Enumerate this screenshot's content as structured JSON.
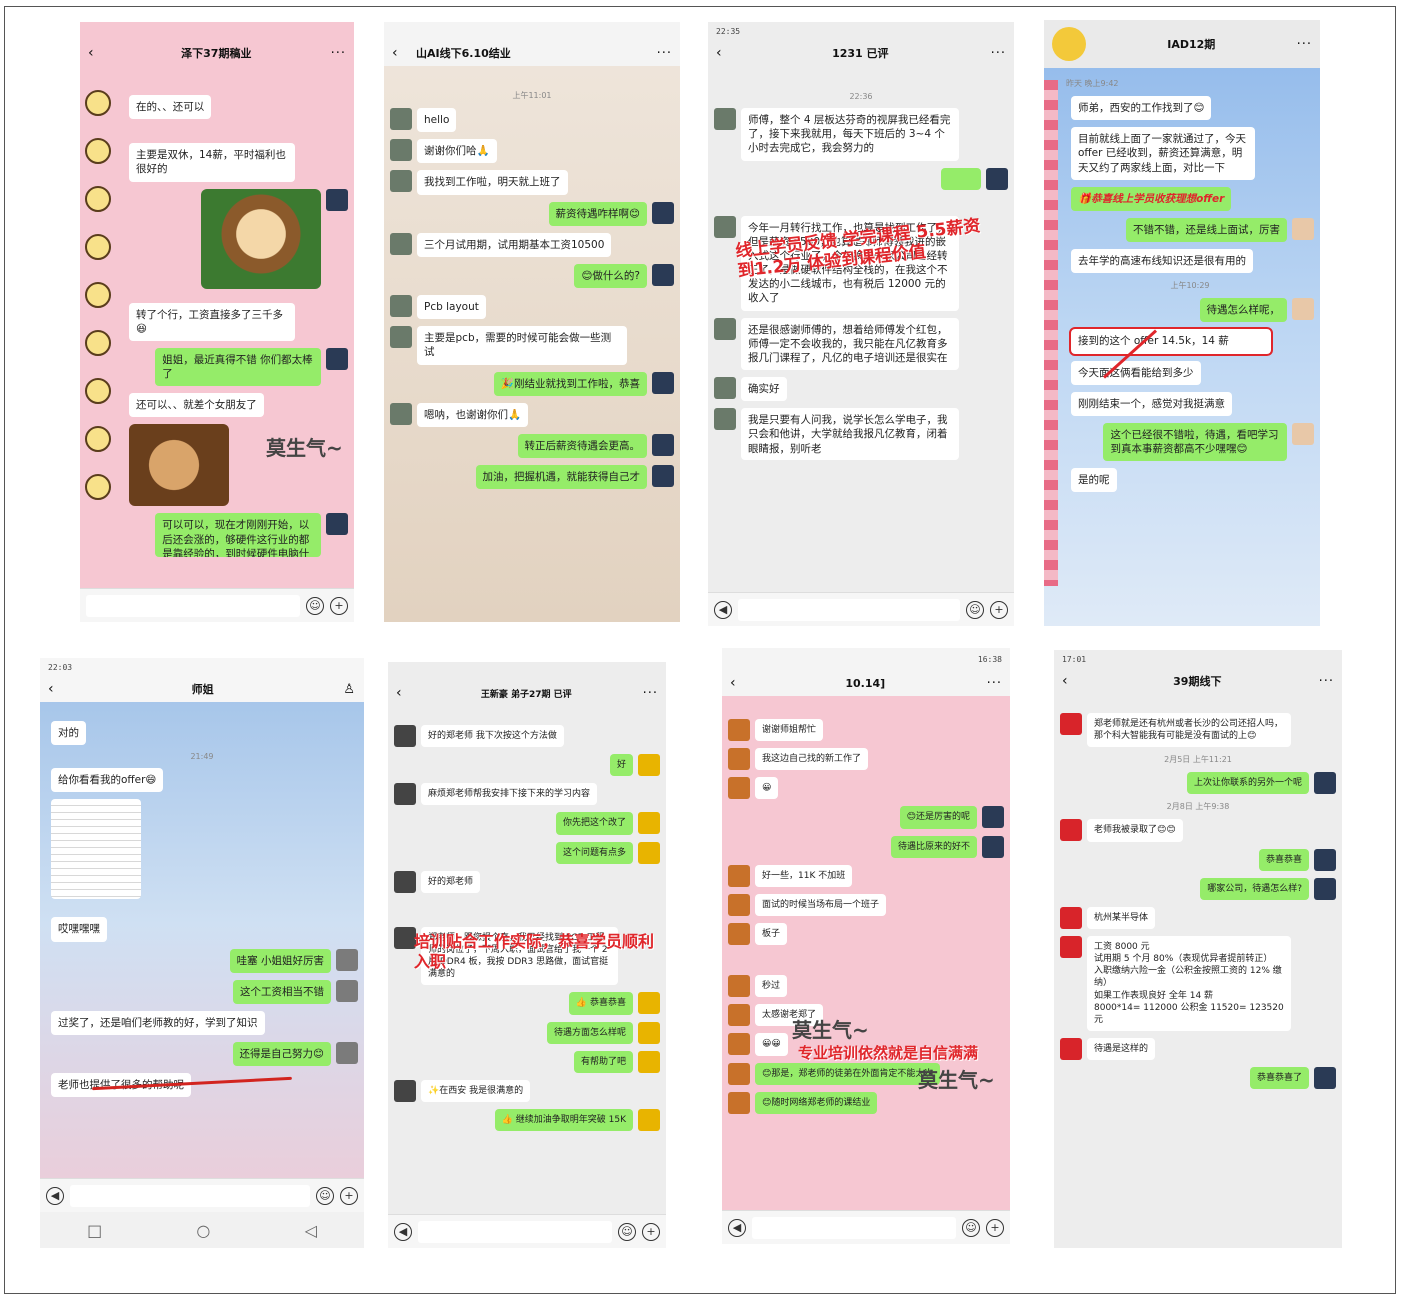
{
  "colors": {
    "wechat_green": "#95ec69",
    "bubble_white": "#ffffff",
    "highlight_red": "#e0262b",
    "pink_wallpaper": "#f6c7d2"
  },
  "icons": {
    "voice": "voice-icon",
    "emoji": "emoji-icon",
    "add": "add-icon",
    "back": "back-arrow-icon",
    "more": "more-icon",
    "person": "person-icon"
  },
  "p1": {
    "status": "",
    "title": "泽下37期稿业",
    "messages": [
      "在的、、还可以",
      "主要是双休，14薪，平时福利也很好的",
      "转了个行，工资直接多了三千多😆",
      "姐姐，最近真得不错 你们都太棒了",
      "还可以、、就差个女朋友了",
      "可以可以，现在才刚刚开始，以后还会涨的，够硬件这行业的都是靠经验的，到时候硬件电脑什么的都可以了"
    ],
    "overlay": "莫生气~"
  },
  "p2": {
    "title": "山AI线下6.10结业",
    "time1": "上午11:01",
    "messages": [
      "hello",
      "谢谢你们哈🙏",
      "我找到工作啦，明天就上班了",
      "薪资待遇咋样啊😊",
      "三个月试用期，试用期基本工资10500",
      "😊做什么的?",
      "Pcb layout",
      "主要是pcb，需要的时候可能会做一些测试",
      "🎉刚结业就找到工作啦，恭喜",
      "嗯呐，也谢谢你们🙏",
      "转正后薪资待遇会更高。",
      "加油，把握机遇，就能获得自己才"
    ]
  },
  "p3": {
    "status": "22:35",
    "title": "1231 已评",
    "time1": "22:36",
    "messages": [
      "师傅，整个 4 层板达芬奇的视屏我已经看完了，接下来我就用，每天下班后的 3~4 个小时去完成它，我会努力的",
      "今年一月转行找工作，也算是找到工作了，但是薪资 5500，也算是郑师傅领我进的嵌入式这个行业了，今年换了一家公司已经转正了，是做硬软件结构全栈的，在我这个不发达的小二线城市，也有税后 12000 元的收入了",
      "还是很感谢师傅的，想着给师傅发个红包，师傅一定不会收我的，我只能在凡亿教育多报几门课程了，凡亿的电子培训还是很实在",
      "确实好",
      "我是只要有人问我，说学长怎么学电子，我只会和他讲，大学就给我报凡亿教育，闭着眼睛报，别听老"
    ],
    "overlay": "线上学员反馈 学完课程 5.5薪资到1.2万 体验到课程价值"
  },
  "p4": {
    "title": "IAD12期",
    "time1": "昨天 晚上9:42",
    "time2": "上午10:29",
    "messages": [
      "师弟，西安的工作找到了😊",
      "目前就线上面了一家就通过了，今天 offer 已经收到，薪资还算满意，明天又约了两家线上面，对比一下",
      "不错不错，还是线上面试，厉害",
      "去年学的高速布线知识还是很有用的",
      "待遇怎么样呢，",
      "接到的这个 offer 14.5k，14 薪",
      "今天面这俩看能给到多少",
      "刚刚结束一个，感觉对我挺满意",
      "这个已经很不错啦，待遇，看吧学习到真本事薪资都高不少嘿嘿😊",
      "是的呢"
    ],
    "overlay": "🎁恭喜线上学员收获理想offer"
  },
  "p5": {
    "status": "22:03",
    "title": "师姐",
    "time1": "21:49",
    "messages": [
      "对的",
      "给你看看我的offer😄",
      "哎嘿嘿嘿",
      "哇塞 小姐姐好厉害",
      "这个工资相当不错",
      "过奖了，还是咱们老师教的好，学到了知识",
      "还得是自己努力😊",
      "老师也提供了很多的帮助呢"
    ]
  },
  "p6": {
    "title": "王新豪 弟子27期 已评",
    "messages": [
      "好的郑老师 我下次按这个方法做",
      "好",
      "麻烦郑老师帮我安排下接下来的学习内容",
      "你先把这个改了",
      "这个问题有点多",
      "好的郑老师",
      "郑老师，跟您报个喜，我已经找到 PCB 工程师的岗位了，下周入职，面试官给了我一个 2 片 DDR4 板，我按 DDR3 思路做，面试官挺满意的",
      "👍 恭喜恭喜",
      "待遇方面怎么样呢",
      "有帮助了吧",
      "✨在西安 我是很满意的",
      "👍 继续加油争取明年突破 15K"
    ],
    "overlay": "培训贴合工作实际，恭喜学员顺利入职"
  },
  "p7": {
    "status": "16:38",
    "title": "10.14]",
    "messages": [
      "谢谢师姐帮忙",
      "我这边自己找的新工作了",
      "😀",
      "😊还是厉害的呢",
      "待遇比原来的好不",
      "好一些，11K 不加班",
      "面试的时候当场布局一个班子",
      "板子",
      "秒过",
      "太感谢老郑了",
      "😀😀",
      "😊那是，郑老师的徒弟在外面肯定不能太次",
      "😊随时网络郑老师的课结业"
    ],
    "overlay1": "莫生气~",
    "overlay2": "专业培训依然就是自信满满"
  },
  "p8": {
    "status": "17:01",
    "title": "39期线下",
    "time1": "2月5日 上午11:21",
    "time2": "2月8日 上午9:38",
    "messages": [
      "郑老师就是还有杭州或者长沙的公司还招人吗，那个科大智能我有可能是没有面试的上😊",
      "上次让你联系的另外一个呢",
      "老师我被录取了😊😊",
      "恭喜恭喜",
      "哪家公司，待遇怎么样?",
      "杭州某半导体",
      "工资 8000 元\n试用期 5 个月 80%（表现优异者提前转正）\n入职缴纳六险一金（公积金按照工资的 12% 缴纳）\n如果工作表现良好 全年 14 薪\n8000*14= 112000 公积金 11520= 123520 元",
      "待遇是这样的",
      "恭喜恭喜了"
    ]
  }
}
